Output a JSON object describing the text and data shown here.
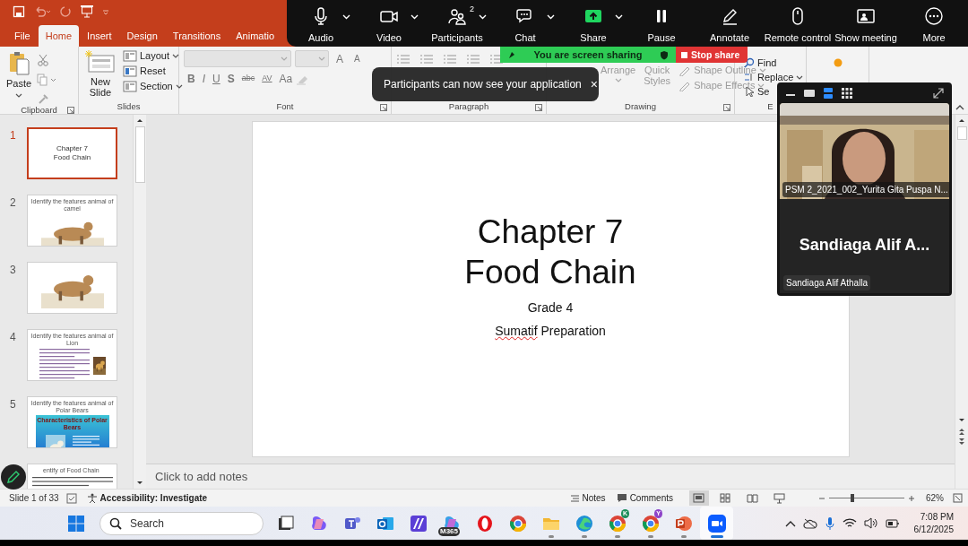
{
  "tabs": [
    {
      "label": "File",
      "selected": false
    },
    {
      "label": "Home",
      "selected": true
    },
    {
      "label": "Insert",
      "selected": false
    },
    {
      "label": "Design",
      "selected": false
    },
    {
      "label": "Transitions",
      "selected": false
    },
    {
      "label": "Animatio",
      "selected": false
    }
  ],
  "ribbon": {
    "clipboard": {
      "paste": "Paste",
      "label": "Clipboard"
    },
    "slides": {
      "new_slide": "New Slide",
      "layout": "Layout",
      "reset": "Reset",
      "section": "Section",
      "label": "Slides"
    },
    "font": {
      "grow": "A",
      "shrink": "A",
      "format_buttons": [
        {
          "kind": "bold",
          "glyph": "B"
        },
        {
          "kind": "italic",
          "glyph": "I"
        },
        {
          "kind": "underline",
          "glyph": "U"
        },
        {
          "kind": "shadow",
          "glyph": "S"
        },
        {
          "kind": "strike",
          "glyph": "abc"
        },
        {
          "kind": "spacing",
          "glyph": "AV"
        },
        {
          "kind": "case",
          "glyph": "Aa"
        }
      ],
      "label": "Font"
    },
    "paragraph": {
      "label": "Paragraph"
    },
    "drawing": {
      "arrange": "Arrange",
      "quick_styles": "Quick Styles",
      "shape_outline": "Shape Outline",
      "shape_effects": "Shape Effects",
      "label": "Drawing"
    },
    "editing": {
      "find": "Find",
      "replace": "Replace",
      "select": "Se",
      "label": "E"
    }
  },
  "meeting_toolbar": {
    "items": [
      {
        "kind": "audio",
        "label": "Audio",
        "caret": true
      },
      {
        "kind": "video",
        "label": "Video",
        "caret": true
      },
      {
        "kind": "participants",
        "label": "Participants",
        "caret": true,
        "count": "2"
      },
      {
        "kind": "chat",
        "label": "Chat",
        "caret": true
      },
      {
        "kind": "share",
        "label": "Share",
        "caret": true
      },
      {
        "kind": "pause",
        "label": "Pause",
        "caret": false
      },
      {
        "kind": "annotate",
        "label": "Annotate",
        "caret": false
      },
      {
        "kind": "remote",
        "label": "Remote control",
        "caret": false
      },
      {
        "kind": "show",
        "label": "Show meeting",
        "caret": false
      },
      {
        "kind": "more",
        "label": "More",
        "caret": false
      }
    ]
  },
  "share_banner": {
    "status": "You are screen sharing",
    "stop": "Stop share"
  },
  "toast": {
    "message": "Participants can now see your application",
    "close": "×"
  },
  "slide_panel": {
    "slides": [
      {
        "number": "1",
        "selected": true,
        "kind": "title",
        "lines": [
          "Chapter 7",
          "Food Chain"
        ]
      },
      {
        "number": "2",
        "selected": false,
        "kind": "picture",
        "title": "Identify the features animal of camel"
      },
      {
        "number": "3",
        "selected": false,
        "kind": "picture"
      },
      {
        "number": "4",
        "selected": false,
        "kind": "bullets",
        "title": "Identify the features animal of Lion"
      },
      {
        "number": "5",
        "selected": false,
        "kind": "banner",
        "title": "Identify the features animal of Polar Bears",
        "heading": "Characteristics of Polar Bears"
      },
      {
        "selected": false,
        "kind": "text",
        "title": "entify of Food Chain"
      }
    ]
  },
  "slide": {
    "title_lines": [
      "Chapter 7",
      "Food Chain"
    ],
    "subtitle_lines": [
      {
        "words": [
          {
            "text": "Grade 4",
            "misspelled": false
          }
        ]
      },
      {
        "words": [
          {
            "text": "Sumatif",
            "misspelled": true
          },
          {
            "text": "Preparation",
            "misspelled": false
          }
        ]
      }
    ]
  },
  "notes_placeholder": "Click to add notes",
  "video_panel": {
    "view_modes": [
      {
        "kind": "minimize",
        "selected": false
      },
      {
        "kind": "single",
        "selected": false
      },
      {
        "kind": "stacked",
        "selected": true
      },
      {
        "kind": "grid",
        "selected": false
      }
    ],
    "tiles": [
      {
        "kind": "video",
        "name": "PSM 2_2021_002_Yurita Gita Puspa N..."
      },
      {
        "kind": "avatar",
        "display": "Sandiaga Alif A...",
        "name": "Sandiaga Alif Athalla"
      }
    ]
  },
  "status_bar": {
    "slide_count": "Slide 1 of 33",
    "accessibility": "Accessibility: Investigate",
    "notes": "Notes",
    "comments": "Comments",
    "views": [
      {
        "kind": "normal",
        "selected": true
      },
      {
        "kind": "sorter",
        "selected": false
      },
      {
        "kind": "reading",
        "selected": false
      },
      {
        "kind": "show",
        "selected": false
      }
    ],
    "zoom": {
      "level": 0.3,
      "percent": "62%"
    }
  },
  "taskbar": {
    "search_placeholder": "Search",
    "apps": [
      {
        "kind": "taskview",
        "running": false,
        "focused": false
      },
      {
        "kind": "copilot",
        "running": false,
        "focused": false
      },
      {
        "kind": "teams",
        "running": false,
        "focused": false
      },
      {
        "kind": "outlook",
        "running": false,
        "focused": false
      },
      {
        "kind": "designer",
        "running": false,
        "focused": false
      },
      {
        "kind": "m365",
        "running": false,
        "focused": false,
        "badge": "M365"
      },
      {
        "kind": "opera",
        "running": false,
        "focused": false
      },
      {
        "kind": "chrome",
        "running": false,
        "focused": false
      },
      {
        "kind": "files",
        "running": true,
        "focused": false
      },
      {
        "kind": "edge",
        "running": true,
        "focused": false
      },
      {
        "kind": "chrome",
        "running": true,
        "focused": false,
        "badge": "K",
        "color": "#1e8e5a"
      },
      {
        "kind": "chrome",
        "running": true,
        "focused": false,
        "badge": "Y",
        "color": "#8e44c8"
      },
      {
        "kind": "powerpoint",
        "running": true,
        "focused": false
      },
      {
        "kind": "zoom",
        "running": true,
        "focused": true
      }
    ],
    "time": "7:08 PM",
    "date": "6/12/2025"
  }
}
